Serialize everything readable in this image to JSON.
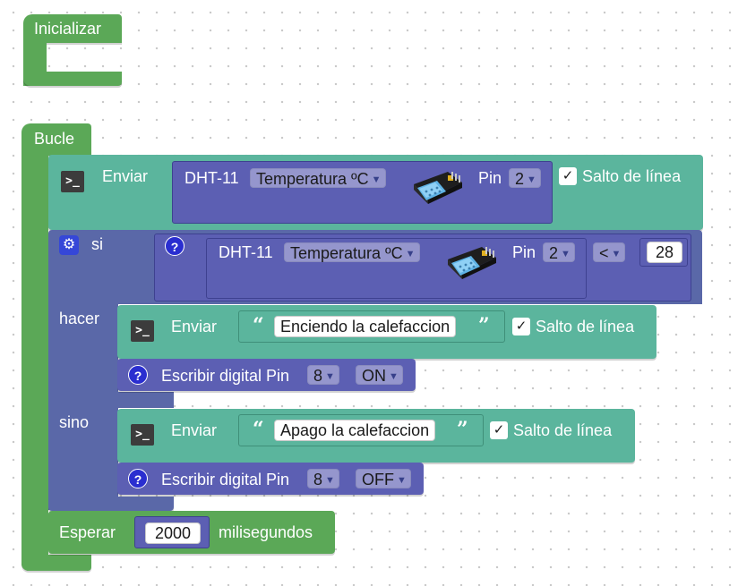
{
  "blocks": {
    "init": {
      "label": "Inicializar"
    },
    "loop": {
      "label": "Bucle"
    },
    "send1": {
      "label": "Enviar",
      "sensor": "DHT-11",
      "measure": "Temperatura ºC",
      "pin_label": "Pin",
      "pin_value": "2",
      "newline_label": "Salto de línea",
      "newline_checked": "✓"
    },
    "if": {
      "label": "si",
      "do_label": "hacer",
      "else_label": "sino",
      "cond": {
        "sensor": "DHT-11",
        "measure": "Temperatura ºC",
        "pin_label": "Pin",
        "pin_value": "2",
        "operator": "<",
        "value": "28"
      }
    },
    "send2": {
      "label": "Enviar",
      "text": "Enciendo la calefaccion",
      "newline_label": "Salto de línea",
      "newline_checked": "✓"
    },
    "write1": {
      "label": "Escribir digital Pin",
      "pin": "8",
      "state": "ON"
    },
    "send3": {
      "label": "Enviar",
      "text": "Apago la calefaccion",
      "newline_label": "Salto de línea",
      "newline_checked": "✓"
    },
    "write2": {
      "label": "Escribir digital Pin",
      "pin": "8",
      "state": "OFF"
    },
    "wait": {
      "label": "Esperar",
      "value": "2000",
      "unit": "milisegundos"
    }
  },
  "icons": {
    "terminal": "terminal-icon",
    "help": "help-icon",
    "gear": "gear-icon",
    "sensor": "dht11-sensor-icon",
    "caret": "▼",
    "quote_open": "“",
    "quote_close": "”"
  },
  "colors": {
    "event_green": "#5ba857",
    "serial_teal": "#5bb59d",
    "logic_blue": "#5a68a8",
    "sensor_indigo": "#5c5fb3"
  }
}
